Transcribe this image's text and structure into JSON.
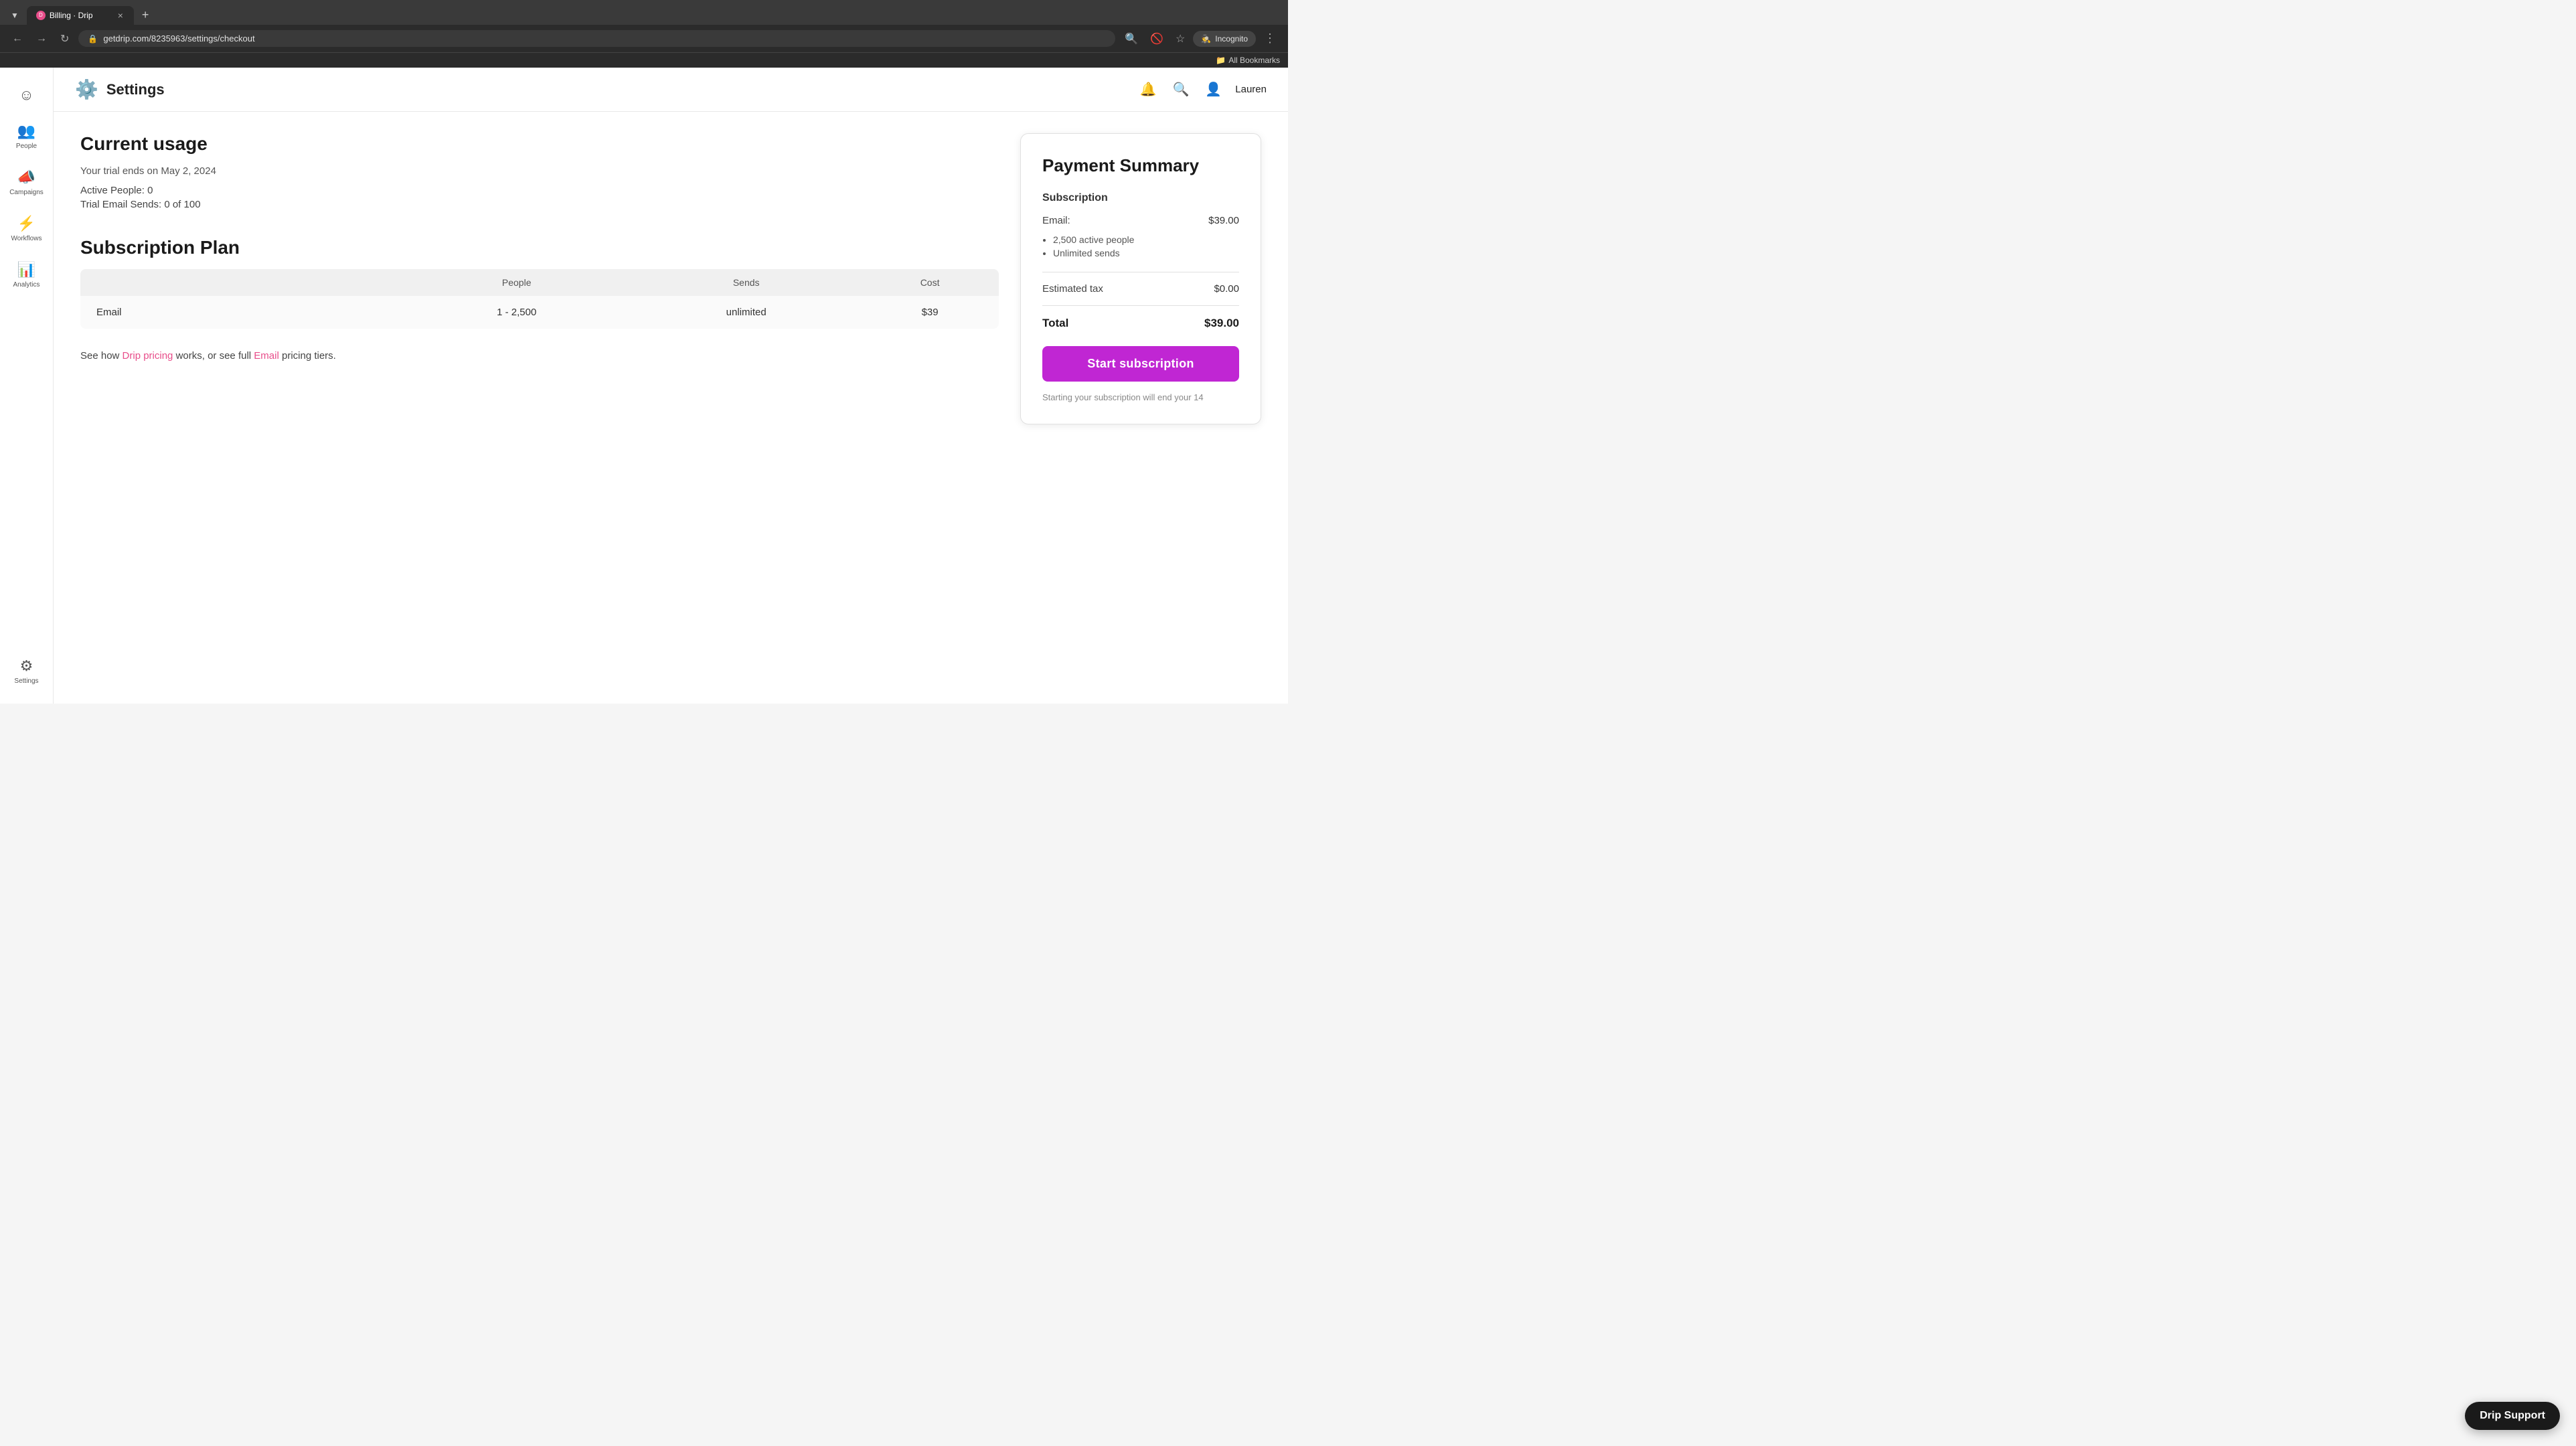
{
  "browser": {
    "tab_favicon_text": "D",
    "tab_title": "Billing · Drip",
    "tab_close_label": "×",
    "tab_new_label": "+",
    "back_btn": "←",
    "forward_btn": "→",
    "refresh_btn": "↻",
    "address_icon": "🔒",
    "address_url": "getdrip.com/8235963/settings/checkout",
    "search_icon": "🔍",
    "eyeoff_icon": "👁",
    "star_icon": "☆",
    "incognito_label": "Incognito",
    "menu_icon": "⋮",
    "bookmarks_icon": "📁",
    "bookmarks_label": "All Bookmarks"
  },
  "sidebar": {
    "items": [
      {
        "id": "logo",
        "icon": "☺",
        "label": ""
      },
      {
        "id": "people",
        "icon": "👥",
        "label": "People"
      },
      {
        "id": "campaigns",
        "icon": "📣",
        "label": "Campaigns"
      },
      {
        "id": "workflows",
        "icon": "⚡",
        "label": "Workflows"
      },
      {
        "id": "analytics",
        "icon": "📊",
        "label": "Analytics"
      }
    ],
    "settings": {
      "icon": "⚙",
      "label": "Settings"
    }
  },
  "header": {
    "settings_icon": "⚙",
    "title": "Settings",
    "bell_icon": "🔔",
    "search_icon": "🔍",
    "user_icon": "👤",
    "user_name": "Lauren"
  },
  "current_usage": {
    "section_title": "Current usage",
    "trial_notice": "Your trial ends on May 2, 2024",
    "active_people_label": "Active People:",
    "active_people_value": "0",
    "trial_sends_label": "Trial Email Sends:",
    "trial_sends_value": "0 of 100"
  },
  "subscription_plan": {
    "section_title": "Subscription Plan",
    "table_headers": [
      "People",
      "Sends",
      "Cost"
    ],
    "rows": [
      {
        "name": "Email",
        "people": "1 - 2,500",
        "sends": "unlimited",
        "cost": "$39"
      }
    ],
    "pricing_note_prefix": "See how ",
    "drip_pricing_link": "Drip pricing",
    "pricing_note_middle": " works, or see full ",
    "email_link": "Email",
    "pricing_note_suffix": " pricing tiers."
  },
  "payment_summary": {
    "title": "Payment Summary",
    "subscription_label": "Subscription",
    "email_label": "Email:",
    "email_value": "$39.00",
    "bullets": [
      "2,500 active people",
      "Unlimited sends"
    ],
    "estimated_tax_label": "Estimated tax",
    "estimated_tax_value": "$0.00",
    "total_label": "Total",
    "total_value": "$39.00",
    "start_btn_label": "Start subscription",
    "subscription_note": "Starting your subscription will end your 14"
  },
  "drip_support": {
    "label": "Drip Support"
  }
}
